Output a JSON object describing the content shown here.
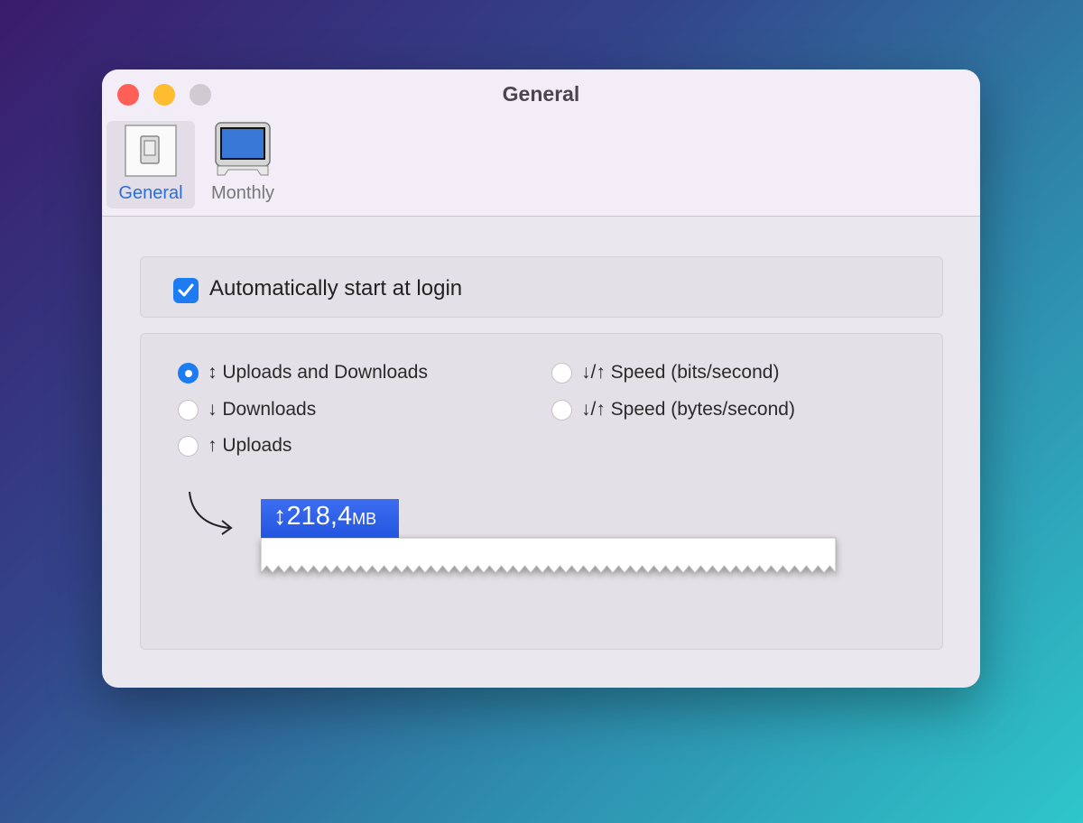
{
  "window": {
    "title": "General"
  },
  "tabs": [
    {
      "label": "General",
      "icon": "switch-icon",
      "selected": true
    },
    {
      "label": "Monthly",
      "icon": "monitor-icon",
      "selected": false
    }
  ],
  "auto_start": {
    "label": "Automatically start at login",
    "checked": true
  },
  "display_options": [
    {
      "label": "↕ Uploads and Downloads",
      "selected": true
    },
    {
      "label": "↓ Downloads",
      "selected": false
    },
    {
      "label": "↑ Uploads",
      "selected": false
    },
    {
      "label": "↓/↑ Speed (bits/second)",
      "selected": false
    },
    {
      "label": "↓/↑ Speed (bytes/second)",
      "selected": false
    }
  ],
  "preview": {
    "arrow": "↕",
    "value": "218,4",
    "unit": "MB"
  },
  "colors": {
    "accent": "#1e7cf2",
    "close": "#fe5f57",
    "minimize": "#febc2e",
    "zoom_disabled": "#d0cbd3"
  }
}
